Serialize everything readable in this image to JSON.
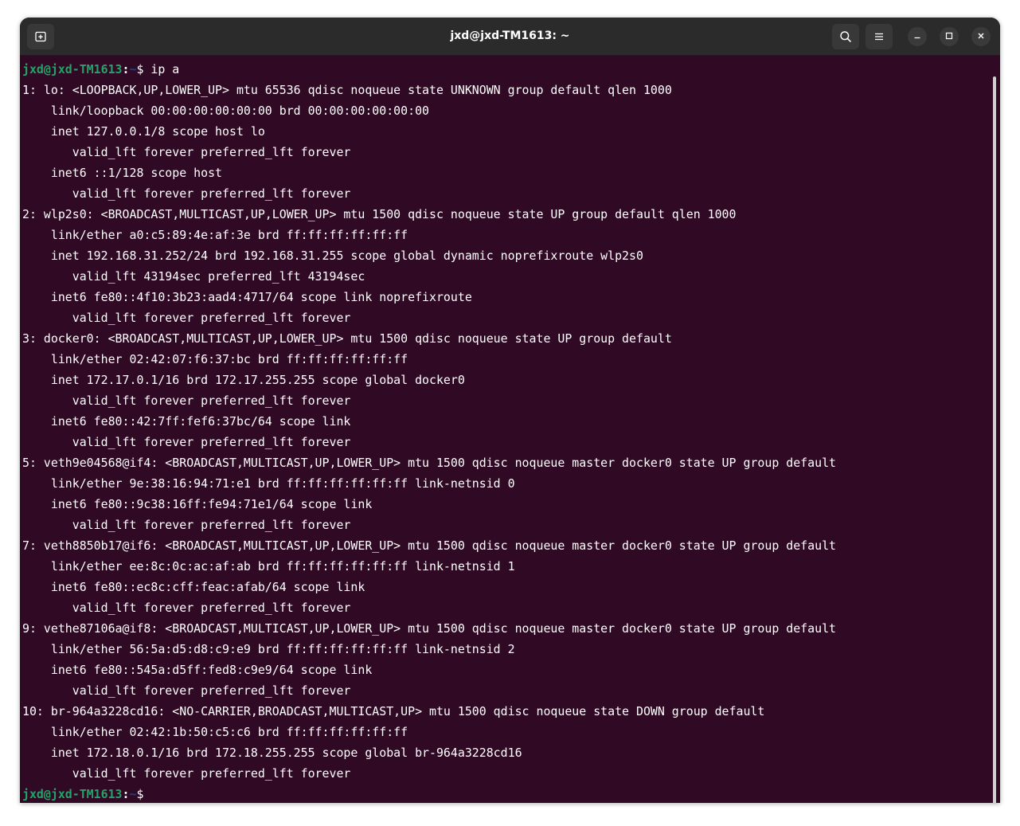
{
  "window": {
    "title": "jxd@jxd-TM1613: ~"
  },
  "titlebar": {
    "new_tab_icon": "new-tab-icon",
    "search_icon": "search-icon",
    "menu_icon": "hamburger-menu-icon",
    "minimize_icon": "minimize-icon",
    "maximize_icon": "maximize-icon",
    "close_icon": "close-icon"
  },
  "colors": {
    "terminal_bg": "#300a24",
    "prompt_user": "#26a269",
    "prompt_path": "#12488b",
    "titlebar_bg": "#2b2b2b"
  },
  "terminal": {
    "prompt": {
      "user_host": "jxd@jxd-TM1613",
      "colon": ":",
      "path": "~",
      "dollar": "$"
    },
    "first_command": " ip a",
    "output": [
      "1: lo: <LOOPBACK,UP,LOWER_UP> mtu 65536 qdisc noqueue state UNKNOWN group default qlen 1000",
      "    link/loopback 00:00:00:00:00:00 brd 00:00:00:00:00:00",
      "    inet 127.0.0.1/8 scope host lo",
      "       valid_lft forever preferred_lft forever",
      "    inet6 ::1/128 scope host",
      "       valid_lft forever preferred_lft forever",
      "2: wlp2s0: <BROADCAST,MULTICAST,UP,LOWER_UP> mtu 1500 qdisc noqueue state UP group default qlen 1000",
      "    link/ether a0:c5:89:4e:af:3e brd ff:ff:ff:ff:ff:ff",
      "    inet 192.168.31.252/24 brd 192.168.31.255 scope global dynamic noprefixroute wlp2s0",
      "       valid_lft 43194sec preferred_lft 43194sec",
      "    inet6 fe80::4f10:3b23:aad4:4717/64 scope link noprefixroute",
      "       valid_lft forever preferred_lft forever",
      "3: docker0: <BROADCAST,MULTICAST,UP,LOWER_UP> mtu 1500 qdisc noqueue state UP group default",
      "    link/ether 02:42:07:f6:37:bc brd ff:ff:ff:ff:ff:ff",
      "    inet 172.17.0.1/16 brd 172.17.255.255 scope global docker0",
      "       valid_lft forever preferred_lft forever",
      "    inet6 fe80::42:7ff:fef6:37bc/64 scope link",
      "       valid_lft forever preferred_lft forever",
      "5: veth9e04568@if4: <BROADCAST,MULTICAST,UP,LOWER_UP> mtu 1500 qdisc noqueue master docker0 state UP group default",
      "    link/ether 9e:38:16:94:71:e1 brd ff:ff:ff:ff:ff:ff link-netnsid 0",
      "    inet6 fe80::9c38:16ff:fe94:71e1/64 scope link",
      "       valid_lft forever preferred_lft forever",
      "7: veth8850b17@if6: <BROADCAST,MULTICAST,UP,LOWER_UP> mtu 1500 qdisc noqueue master docker0 state UP group default",
      "    link/ether ee:8c:0c:ac:af:ab brd ff:ff:ff:ff:ff:ff link-netnsid 1",
      "    inet6 fe80::ec8c:cff:feac:afab/64 scope link",
      "       valid_lft forever preferred_lft forever",
      "9: vethe87106a@if8: <BROADCAST,MULTICAST,UP,LOWER_UP> mtu 1500 qdisc noqueue master docker0 state UP group default",
      "    link/ether 56:5a:d5:d8:c9:e9 brd ff:ff:ff:ff:ff:ff link-netnsid 2",
      "    inet6 fe80::545a:d5ff:fed8:c9e9/64 scope link",
      "       valid_lft forever preferred_lft forever",
      "10: br-964a3228cd16: <NO-CARRIER,BROADCAST,MULTICAST,UP> mtu 1500 qdisc noqueue state DOWN group default",
      "    link/ether 02:42:1b:50:c5:c6 brd ff:ff:ff:ff:ff:ff",
      "    inet 172.18.0.1/16 brd 172.18.255.255 scope global br-964a3228cd16",
      "       valid_lft forever preferred_lft forever"
    ],
    "last_command": ""
  }
}
